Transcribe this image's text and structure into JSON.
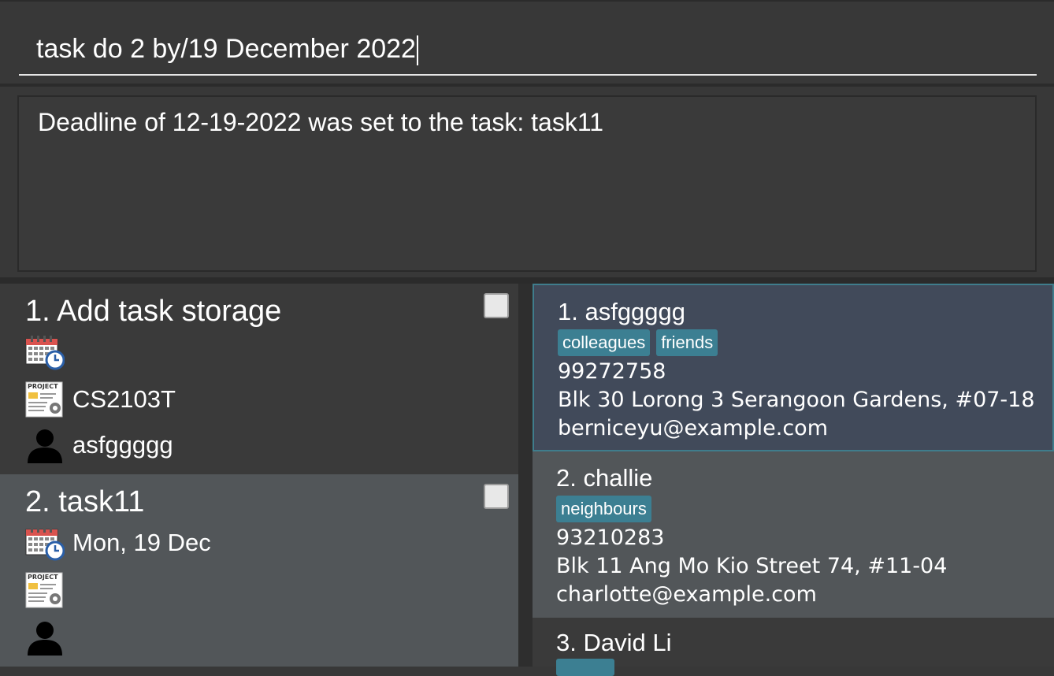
{
  "command": {
    "value": "task do 2 by/19 December 2022"
  },
  "result": {
    "message": "Deadline of 12-19-2022 was set to the task: task11"
  },
  "tasks": [
    {
      "title": "1. Add task storage",
      "deadline": "",
      "project": "CS2103T",
      "assignee": "asfggggg",
      "done": false
    },
    {
      "title": "2. task11",
      "deadline": "Mon, 19 Dec",
      "project": "",
      "assignee": "",
      "done": false
    }
  ],
  "persons": [
    {
      "name": "1.  asfggggg",
      "tags": [
        "colleagues",
        "friends"
      ],
      "phone": "99272758",
      "address": "Blk 30 Lorong 3 Serangoon Gardens, #07-18",
      "email": "berniceyu@example.com"
    },
    {
      "name": "2.  challie",
      "tags": [
        "neighbours"
      ],
      "phone": "93210283",
      "address": "Blk 11 Ang Mo Kio Street 74, #11-04",
      "email": "charlotte@example.com"
    },
    {
      "name": "3.  David Li"
    }
  ],
  "icons": {
    "deadline": "calendar-clock-icon",
    "project": "project-document-icon",
    "assignee": "person-icon"
  },
  "colors": {
    "background": "#383838",
    "selected_task": "#525659",
    "selected_person": "#414a5a",
    "tag": "#3c7f92"
  }
}
